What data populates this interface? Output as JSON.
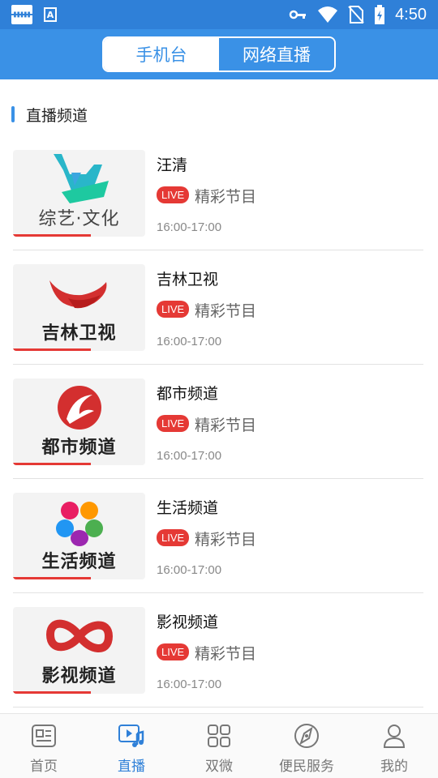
{
  "status_bar": {
    "time": "4:50",
    "app_icon_1": "ᚔ",
    "app_icon_2": "A"
  },
  "header": {
    "tabs": [
      {
        "label": "手机台",
        "active": true
      },
      {
        "label": "网络直播",
        "active": false
      }
    ]
  },
  "section": {
    "title": "直播频道"
  },
  "channels": [
    {
      "name": "汪清",
      "badge": "LIVE",
      "program": "精彩节目",
      "time": "16:00-17:00",
      "logo_caption": "综艺·文化"
    },
    {
      "name": "吉林卫视",
      "badge": "LIVE",
      "program": "精彩节目",
      "time": "16:00-17:00",
      "logo_caption": "吉林卫视"
    },
    {
      "name": "都市频道",
      "badge": "LIVE",
      "program": "精彩节目",
      "time": "16:00-17:00",
      "logo_caption": "都市频道"
    },
    {
      "name": "生活频道",
      "badge": "LIVE",
      "program": "精彩节目",
      "time": "16:00-17:00",
      "logo_caption": "生活频道"
    },
    {
      "name": "影视频道",
      "badge": "LIVE",
      "program": "精彩节目",
      "time": "16:00-17:00",
      "logo_caption": "影视频道"
    }
  ],
  "tabbar": {
    "items": [
      {
        "label": "首页",
        "icon": "news-icon",
        "active": false
      },
      {
        "label": "直播",
        "icon": "video-music-icon",
        "active": true
      },
      {
        "label": "双微",
        "icon": "grid-icon",
        "active": false
      },
      {
        "label": "便民服务",
        "icon": "compass-icon",
        "active": false
      },
      {
        "label": "我的",
        "icon": "user-icon",
        "active": false
      }
    ]
  },
  "colors": {
    "primary": "#3a91e6",
    "live": "#e53935"
  }
}
